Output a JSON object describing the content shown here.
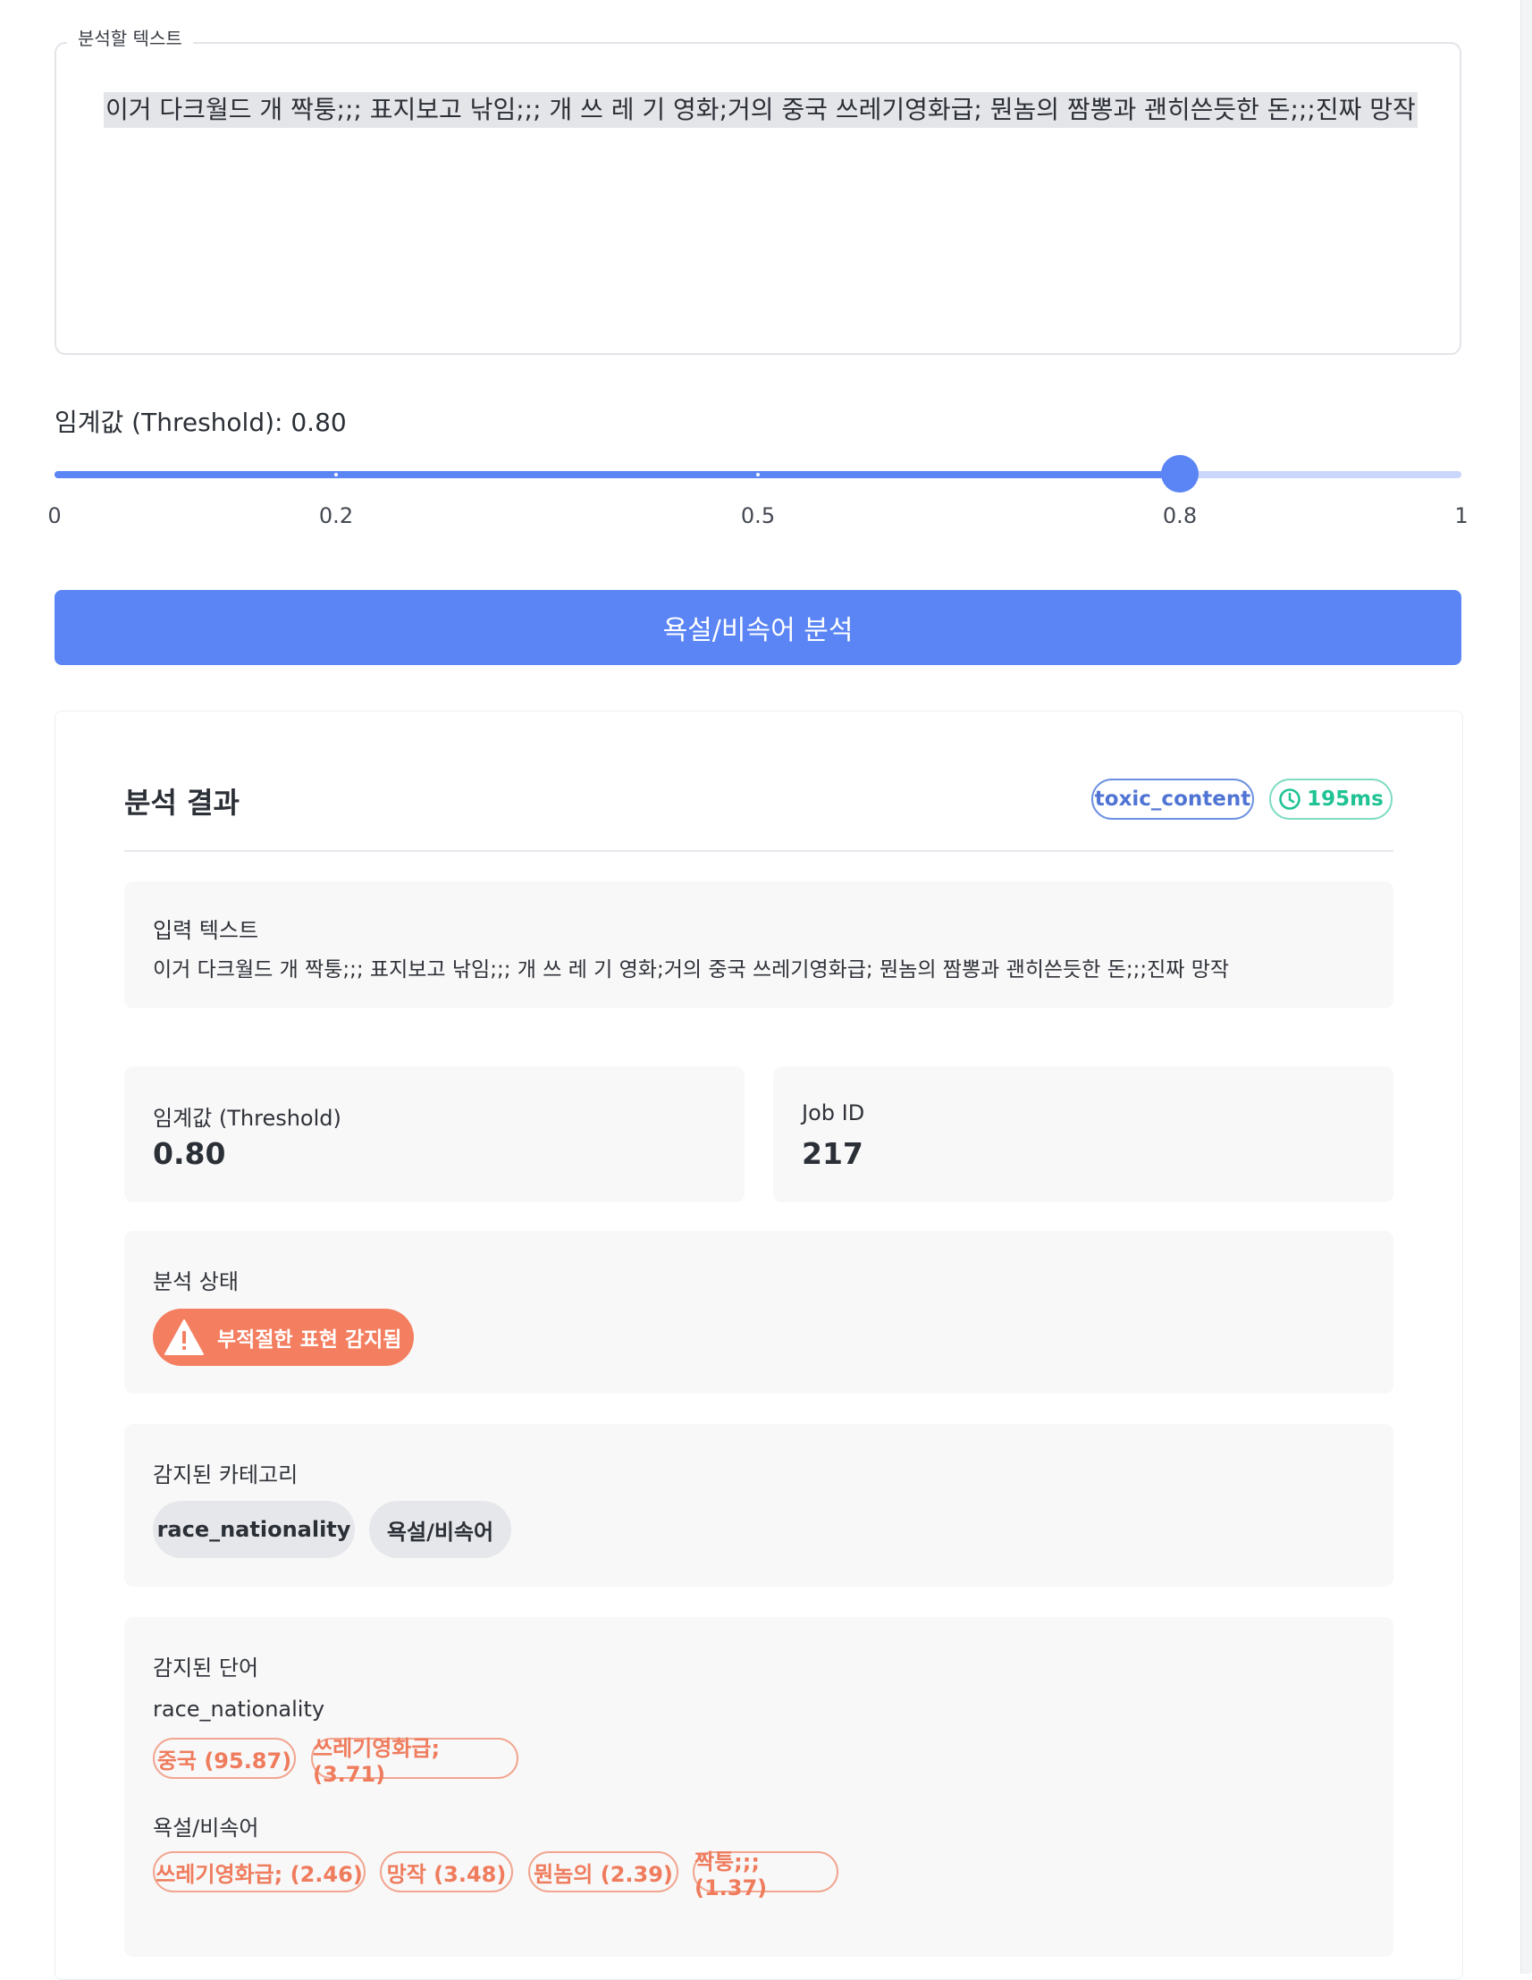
{
  "input": {
    "legend": "분석할 텍스트",
    "value": "이거 다크월드 개 짝퉁;;; 표지보고 낚임;;; 개 쓰 레 기 영화;거의 중국 쓰레기영화급; 뭔놈의 짬뽕과 괜히쓴듯한 돈;;;진짜 망작"
  },
  "threshold": {
    "label": "임계값 (Threshold): 0.80",
    "value": 0.8,
    "marks": [
      "0",
      "0.2",
      "0.5",
      "0.8",
      "1"
    ]
  },
  "analyze_button": "욕설/비속어 분석",
  "result": {
    "title": "분석 결과",
    "type_badge": "toxic_content",
    "time_badge": "195ms",
    "input_label": "입력 텍스트",
    "input_text": "이거 다크월드 개 짝퉁;;; 표지보고 낚임;;; 개 쓰 레 기 영화;거의 중국 쓰레기영화급; 뭔놈의 짬뽕과 괜히쓴듯한 돈;;;진짜 망작",
    "threshold_label": "임계값 (Threshold)",
    "threshold_value": "0.80",
    "job_label": "Job ID",
    "job_value": "217",
    "status_label": "분석 상태",
    "status_text": "부적절한 표현 감지됨",
    "categories_label": "감지된 카테고리",
    "categories": [
      "race_nationality",
      "욕설/비속어"
    ],
    "words_label": "감지된 단어",
    "word_groups": [
      {
        "name": "race_nationality",
        "words": [
          "중국 (95.87)",
          "쓰레기영화급; (3.71)"
        ]
      },
      {
        "name": "욕설/비속어",
        "words": [
          "쓰레기영화급; (2.46)",
          "망작 (3.48)",
          "뭔놈의 (2.39)",
          "짝퉁;;; (1.37)"
        ]
      }
    ]
  },
  "colors": {
    "accent": "#5b85f5",
    "track_light": "#cbd6fb",
    "alert": "#f47e60",
    "success": "#20c394",
    "panel_bg": "#f8f8f9"
  }
}
